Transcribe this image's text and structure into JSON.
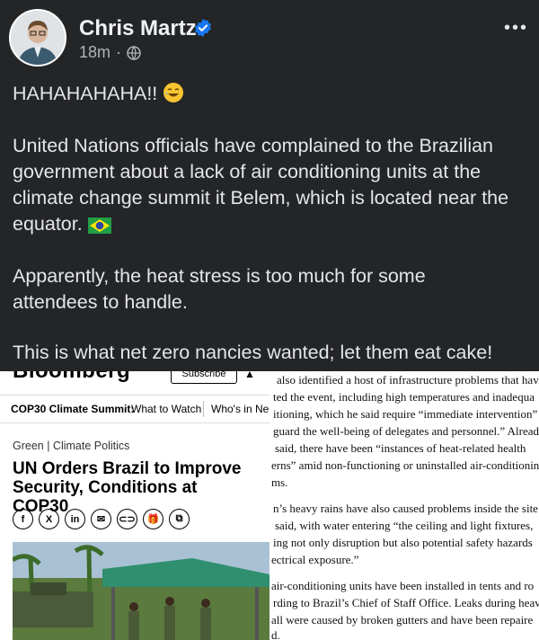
{
  "post": {
    "author": "Chris Martz",
    "time": "18m",
    "dot": "·",
    "more": "•••",
    "lines": [
      "HAHAHAHAHA!!",
      "United Nations officials have complained to the Brazilian",
      "government about a lack of air conditioning units at the",
      "climate change summit it Belem, which is located near the",
      "equator.",
      "Apparently, the heat stress is too much for some",
      "attendees to handle.",
      "This is what net zero nancies wanted; let them eat cake!"
    ],
    "icons": [
      "verified-badge-icon",
      "globe-icon",
      "laughing-emoji",
      "brazil-flag-emoji"
    ]
  },
  "article": {
    "brand": "Bloomberg",
    "subscribe": "Subscribe",
    "nav": [
      "COP30 Climate Summit:",
      "What to Watch",
      "Who's in Neg"
    ],
    "kicker": "Green | Climate Politics",
    "headline": "UN Orders Brazil to Improve Security, Conditions at COP30",
    "share_icons": [
      "f",
      "X",
      "in",
      "✉",
      "⊂⊃",
      "🎁",
      "⧉"
    ]
  },
  "clipping": {
    "lines": [
      "also identified a host of infrastructure problems that hav",
      "ted the event, including high temperatures and inadequa",
      "itioning, which he said require “immediate intervention”",
      "guard the well-being of delegates and personnel.” Alread",
      "said, there have been “instances of heat-related health",
      "erns” amid non-functioning or uninstalled air-conditionin",
      "ms.",
      "n’s heavy rains have also caused problems inside the site",
      "said, with water entering “the ceiling and light fixtures,",
      "ing not only disruption but also potential safety hazards",
      "ectrical exposure.”",
      "air-conditioning units have been installed in tents and ro",
      "rding to Brazil’s Chief of Staff Office. Leaks during heavy",
      "all were caused by broken gutters and have been repaire",
      "d."
    ]
  },
  "colors": {
    "bg": "#242526",
    "text": "#e4e6eb",
    "verified": "#1877f2"
  }
}
